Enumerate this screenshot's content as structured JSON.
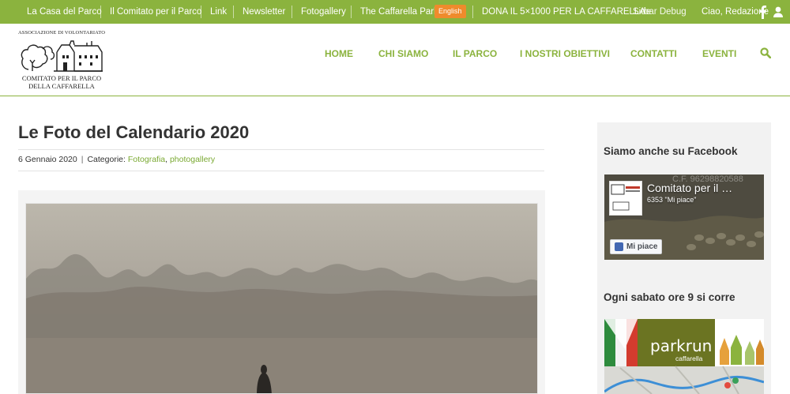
{
  "topbar": {
    "links": [
      "La Casa del Parco",
      "Il Comitato per il Parco",
      "Link",
      "Newsletter",
      "Fotogallery",
      "The Caffarella Park"
    ],
    "language": "English",
    "donate": "DONA IL 5×1000 PER LA CAFFARELLA",
    "sidebar_debug_a": "Side",
    "sidebar_debug_b": "bar Debug",
    "greeting": "Ciao, Redazione",
    "icons": [
      "facebook-icon",
      "user-icon"
    ]
  },
  "logo": {
    "top_text": "ASSOCIAZIONE DI VOLONTARIATO",
    "line1": "COMITATO PER IL PARCO",
    "line2": "DELLA CAFFARELLA"
  },
  "nav": {
    "items": [
      "HOME",
      "CHI SIAMO",
      "IL PARCO",
      "I NOSTRI OBIETTIVI",
      "CONTATTI",
      "EVENTI"
    ],
    "search_icon": "search-icon"
  },
  "post": {
    "title": "Le Foto del Calendario 2020",
    "date": "6 Gennaio 2020",
    "categories_label": "Categorie:",
    "categories": [
      "Fotografia",
      "photogallery"
    ]
  },
  "sidebar": {
    "facebook_title": "Siamo anche su Facebook",
    "facebook_page_name": "Comitato per il …",
    "facebook_likes": "6353 \"Mi piace\"",
    "facebook_like_button": "Mi piace",
    "facebook_cover_code": "C.F. 96298820588",
    "parkrun_title": "Ogni sabato ore 9 si corre",
    "parkrun_logo": "parkrun",
    "parkrun_sub": "caffarella"
  },
  "colors": {
    "brand_green": "#8bb33e",
    "link_green": "#7aa932",
    "lang_orange": "#ef8b2c"
  }
}
